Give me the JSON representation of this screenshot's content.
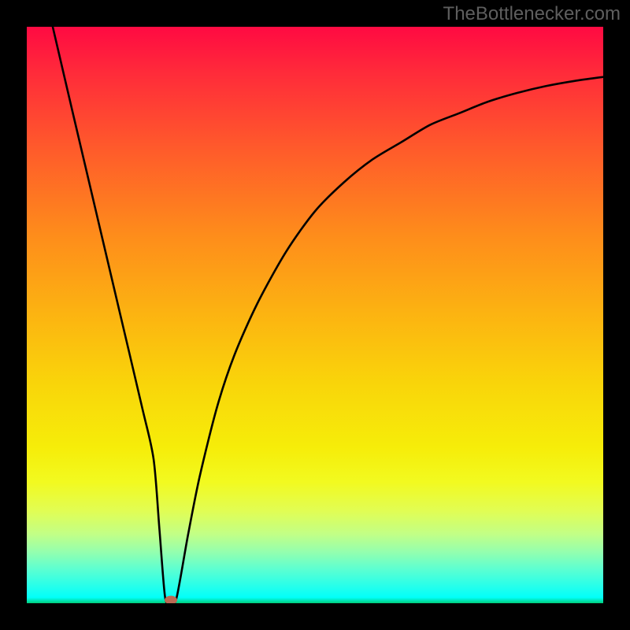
{
  "attribution": "TheBottlenecker.com",
  "colors": {
    "frame": "#000000",
    "curve": "#000000",
    "marker": "#bb6a54"
  },
  "chart_data": {
    "type": "line",
    "title": "",
    "xlabel": "",
    "ylabel": "",
    "xlim": [
      0,
      100
    ],
    "ylim": [
      0,
      100
    ],
    "series": [
      {
        "name": "bottleneck-curve",
        "x": [
          4.5,
          8,
          12,
          16,
          20,
          22,
          23,
          24,
          25,
          26,
          28,
          30,
          33,
          36,
          40,
          45,
          50,
          55,
          60,
          65,
          70,
          75,
          80,
          85,
          90,
          95,
          100
        ],
        "values": [
          100,
          85,
          68,
          51,
          34,
          25,
          13,
          1,
          0,
          1,
          12,
          22,
          34,
          43,
          52,
          61,
          68,
          73,
          77,
          80,
          83,
          85,
          87,
          88.5,
          89.7,
          90.6,
          91.3
        ]
      }
    ],
    "marker": {
      "x": 25,
      "y": 0.5
    },
    "gradient_stops": [
      {
        "pos": 0,
        "color": "#ff0a42"
      },
      {
        "pos": 8,
        "color": "#ff2b3a"
      },
      {
        "pos": 21,
        "color": "#ff5a2b"
      },
      {
        "pos": 36,
        "color": "#fe8c1b"
      },
      {
        "pos": 50,
        "color": "#fcb411"
      },
      {
        "pos": 62,
        "color": "#f9d50a"
      },
      {
        "pos": 73,
        "color": "#f6ed09"
      },
      {
        "pos": 79,
        "color": "#f2fa20"
      },
      {
        "pos": 84,
        "color": "#e1fd54"
      },
      {
        "pos": 88,
        "color": "#c2ff86"
      },
      {
        "pos": 91,
        "color": "#96ffad"
      },
      {
        "pos": 94,
        "color": "#5effd0"
      },
      {
        "pos": 97,
        "color": "#27ffea"
      },
      {
        "pos": 99,
        "color": "#02fff9"
      },
      {
        "pos": 100,
        "color": "#00ce7a"
      }
    ]
  }
}
